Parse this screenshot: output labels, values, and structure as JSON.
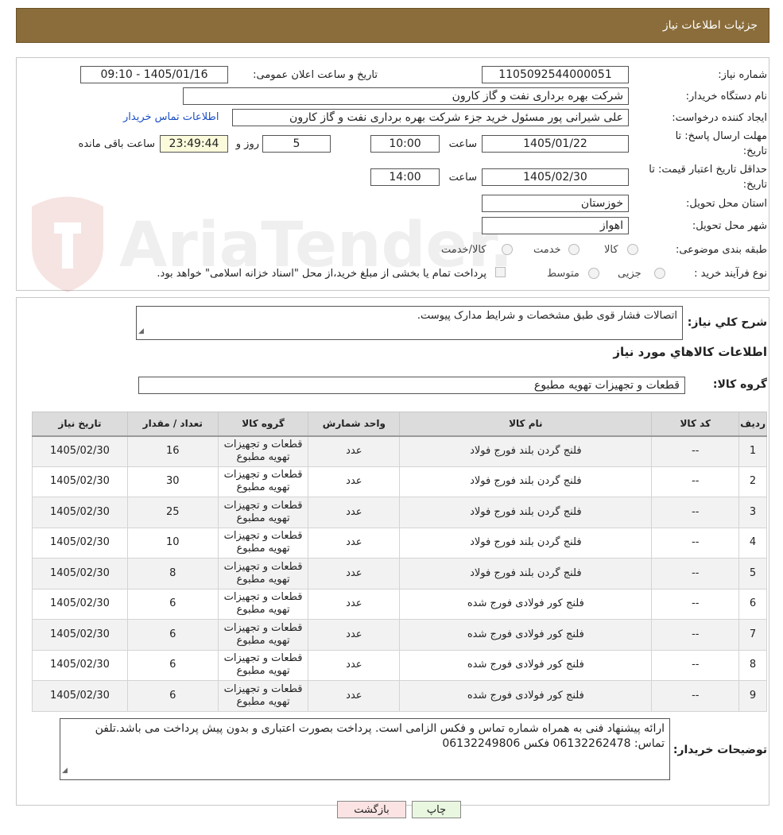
{
  "header": {
    "title": "جزئیات اطلاعات نیاز"
  },
  "form": {
    "need_number": {
      "label": "شماره نیاز:",
      "value": "1105092544000051"
    },
    "announce": {
      "label": "تاریخ و ساعت اعلان عمومی:",
      "value": "1405/01/16 - 09:10"
    },
    "buyer_org": {
      "label": "نام دستگاه خریدار:",
      "value": "شرکت بهره برداری نفت و گاز کارون"
    },
    "creator": {
      "label": "ایجاد کننده درخواست:",
      "value": "علی شیرانی پور مسئول خرید جزء شرکت بهره برداری نفت و گاز کارون"
    },
    "contact_link": "اطلاعات تماس خریدار",
    "deadline": {
      "label_line1": "مهلت ارسال پاسخ: تا",
      "label_line2": "تاریخ:",
      "date": "1405/01/22",
      "time_label": "ساعت",
      "time": "10:00",
      "days": "5",
      "days_label": "روز و",
      "remaining": "23:49:44",
      "remaining_label": "ساعت باقی مانده"
    },
    "validity": {
      "label_line1": "حداقل تاریخ اعتبار قیمت: تا",
      "label_line2": "تاریخ:",
      "date": "1405/02/30",
      "time_label": "ساعت",
      "time": "14:00"
    },
    "province": {
      "label": "استان محل تحویل:",
      "value": "خوزستان"
    },
    "city": {
      "label": "شهر محل تحویل:",
      "value": "اهواز"
    },
    "category": {
      "label": "طبقه بندی موضوعی:",
      "options": [
        "کالا",
        "خدمت",
        "کالا/خدمت"
      ]
    },
    "process": {
      "label": "نوع فرآیند خرید :",
      "options": [
        "جزیی",
        "متوسط"
      ],
      "payment_note": "پرداخت تمام یا بخشی از مبلغ خرید،از محل \"اسناد خزانه اسلامی\" خواهد بود."
    }
  },
  "details": {
    "summary_label": "شرح کلي نياز:",
    "summary_value": "اتصالات فشار قوی طبق مشخصات و شرایط مدارک پیوست.",
    "items_title": "اطلاعات کالاهاي مورد نياز",
    "group_label": "گروه کالا:",
    "group_value": "قطعات و تجهیزات تهویه مطبوع"
  },
  "table": {
    "headers": [
      "ردیف",
      "کد کالا",
      "نام کالا",
      "واحد شمارش",
      "گروه کالا",
      "تعداد / مقدار",
      "تاریخ نیاز"
    ],
    "rows": [
      [
        "1",
        "--",
        "فلنج گردن بلند فورج فولاد",
        "عدد",
        "قطعات و تجهیزات تهویه مطبوع",
        "16",
        "1405/02/30"
      ],
      [
        "2",
        "--",
        "فلنج گردن بلند فورج فولاد",
        "عدد",
        "قطعات و تجهیزات تهویه مطبوع",
        "30",
        "1405/02/30"
      ],
      [
        "3",
        "--",
        "فلنج گردن بلند فورج فولاد",
        "عدد",
        "قطعات و تجهیزات تهویه مطبوع",
        "25",
        "1405/02/30"
      ],
      [
        "4",
        "--",
        "فلنج گردن بلند فورج فولاد",
        "عدد",
        "قطعات و تجهیزات تهویه مطبوع",
        "10",
        "1405/02/30"
      ],
      [
        "5",
        "--",
        "فلنج گردن بلند فورج فولاد",
        "عدد",
        "قطعات و تجهیزات تهویه مطبوع",
        "8",
        "1405/02/30"
      ],
      [
        "6",
        "--",
        "فلنج کور فولادی فورج شده",
        "عدد",
        "قطعات و تجهیزات تهویه مطبوع",
        "6",
        "1405/02/30"
      ],
      [
        "7",
        "--",
        "فلنج کور فولادی فورج شده",
        "عدد",
        "قطعات و تجهیزات تهویه مطبوع",
        "6",
        "1405/02/30"
      ],
      [
        "8",
        "--",
        "فلنج کور فولادی فورج شده",
        "عدد",
        "قطعات و تجهیزات تهویه مطبوع",
        "6",
        "1405/02/30"
      ],
      [
        "9",
        "--",
        "فلنج کور فولادی فورج شده",
        "عدد",
        "قطعات و تجهیزات تهویه مطبوع",
        "6",
        "1405/02/30"
      ]
    ]
  },
  "buyer_notes": {
    "label": "توضیحات خریدار:",
    "value": "ارائه پیشنهاد فنی به همراه شماره تماس و فکس الزامی است. پرداخت بصورت اعتباری و بدون پیش پرداخت می باشد.تلفن تماس: 06132262478 فکس 06132249806"
  },
  "buttons": {
    "print": "چاپ",
    "back": "بازگشت"
  },
  "watermark": {
    "text": "AriaTender.neT"
  },
  "colors": {
    "header": "#8a6d3b",
    "back_button": "#fbe3e3",
    "print_button": "#eaf7e0",
    "timer_bg": "#fbfbdc"
  }
}
